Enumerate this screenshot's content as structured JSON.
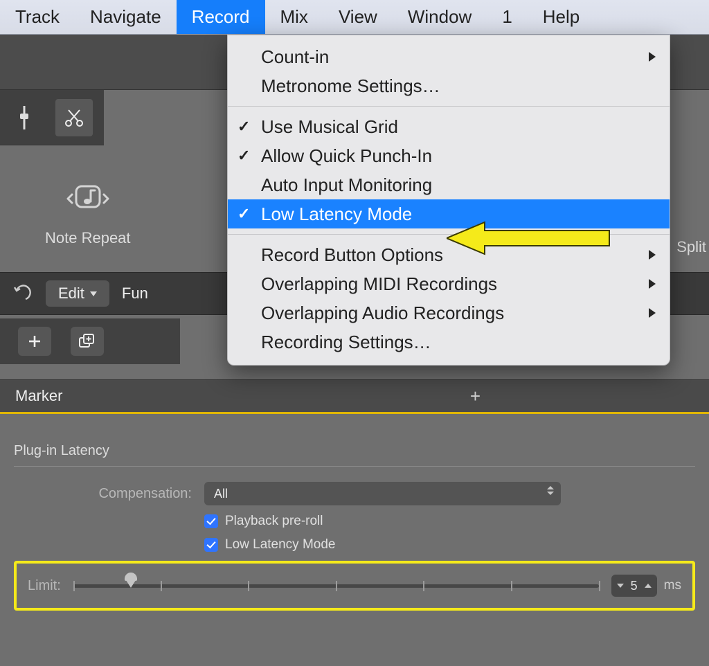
{
  "menubar": {
    "items": [
      {
        "label": "Track"
      },
      {
        "label": "Navigate"
      },
      {
        "label": "Record",
        "active": true
      },
      {
        "label": "Mix"
      },
      {
        "label": "View"
      },
      {
        "label": "Window"
      },
      {
        "label": "1"
      },
      {
        "label": "Help"
      }
    ]
  },
  "dropdown": {
    "items": [
      {
        "label": "Count-in",
        "submenu": true
      },
      {
        "label": "Metronome Settings…"
      },
      {
        "sep": true
      },
      {
        "label": "Use Musical Grid",
        "checked": true
      },
      {
        "label": "Allow Quick Punch-In",
        "checked": true
      },
      {
        "label": "Auto Input Monitoring"
      },
      {
        "label": "Low Latency Mode",
        "checked": true,
        "highlight": true
      },
      {
        "sep": true
      },
      {
        "label": "Record Button Options",
        "submenu": true
      },
      {
        "label": "Overlapping MIDI Recordings",
        "submenu": true
      },
      {
        "label": "Overlapping Audio Recordings",
        "submenu": true
      },
      {
        "label": "Recording Settings…"
      }
    ]
  },
  "noteRepeat": {
    "label": "Note Repeat"
  },
  "splitLabel": "Split",
  "toolbar2": {
    "edit": "Edit",
    "fun": "Fun"
  },
  "marker": {
    "label": "Marker"
  },
  "panel": {
    "title": "Plug-in Latency",
    "compensationLabel": "Compensation:",
    "compensationValue": "All",
    "playbackLabel": "Playback pre-roll",
    "lowLatencyLabel": "Low Latency Mode",
    "limitLabel": "Limit:",
    "limitValue": "5",
    "limitUnit": "ms"
  }
}
